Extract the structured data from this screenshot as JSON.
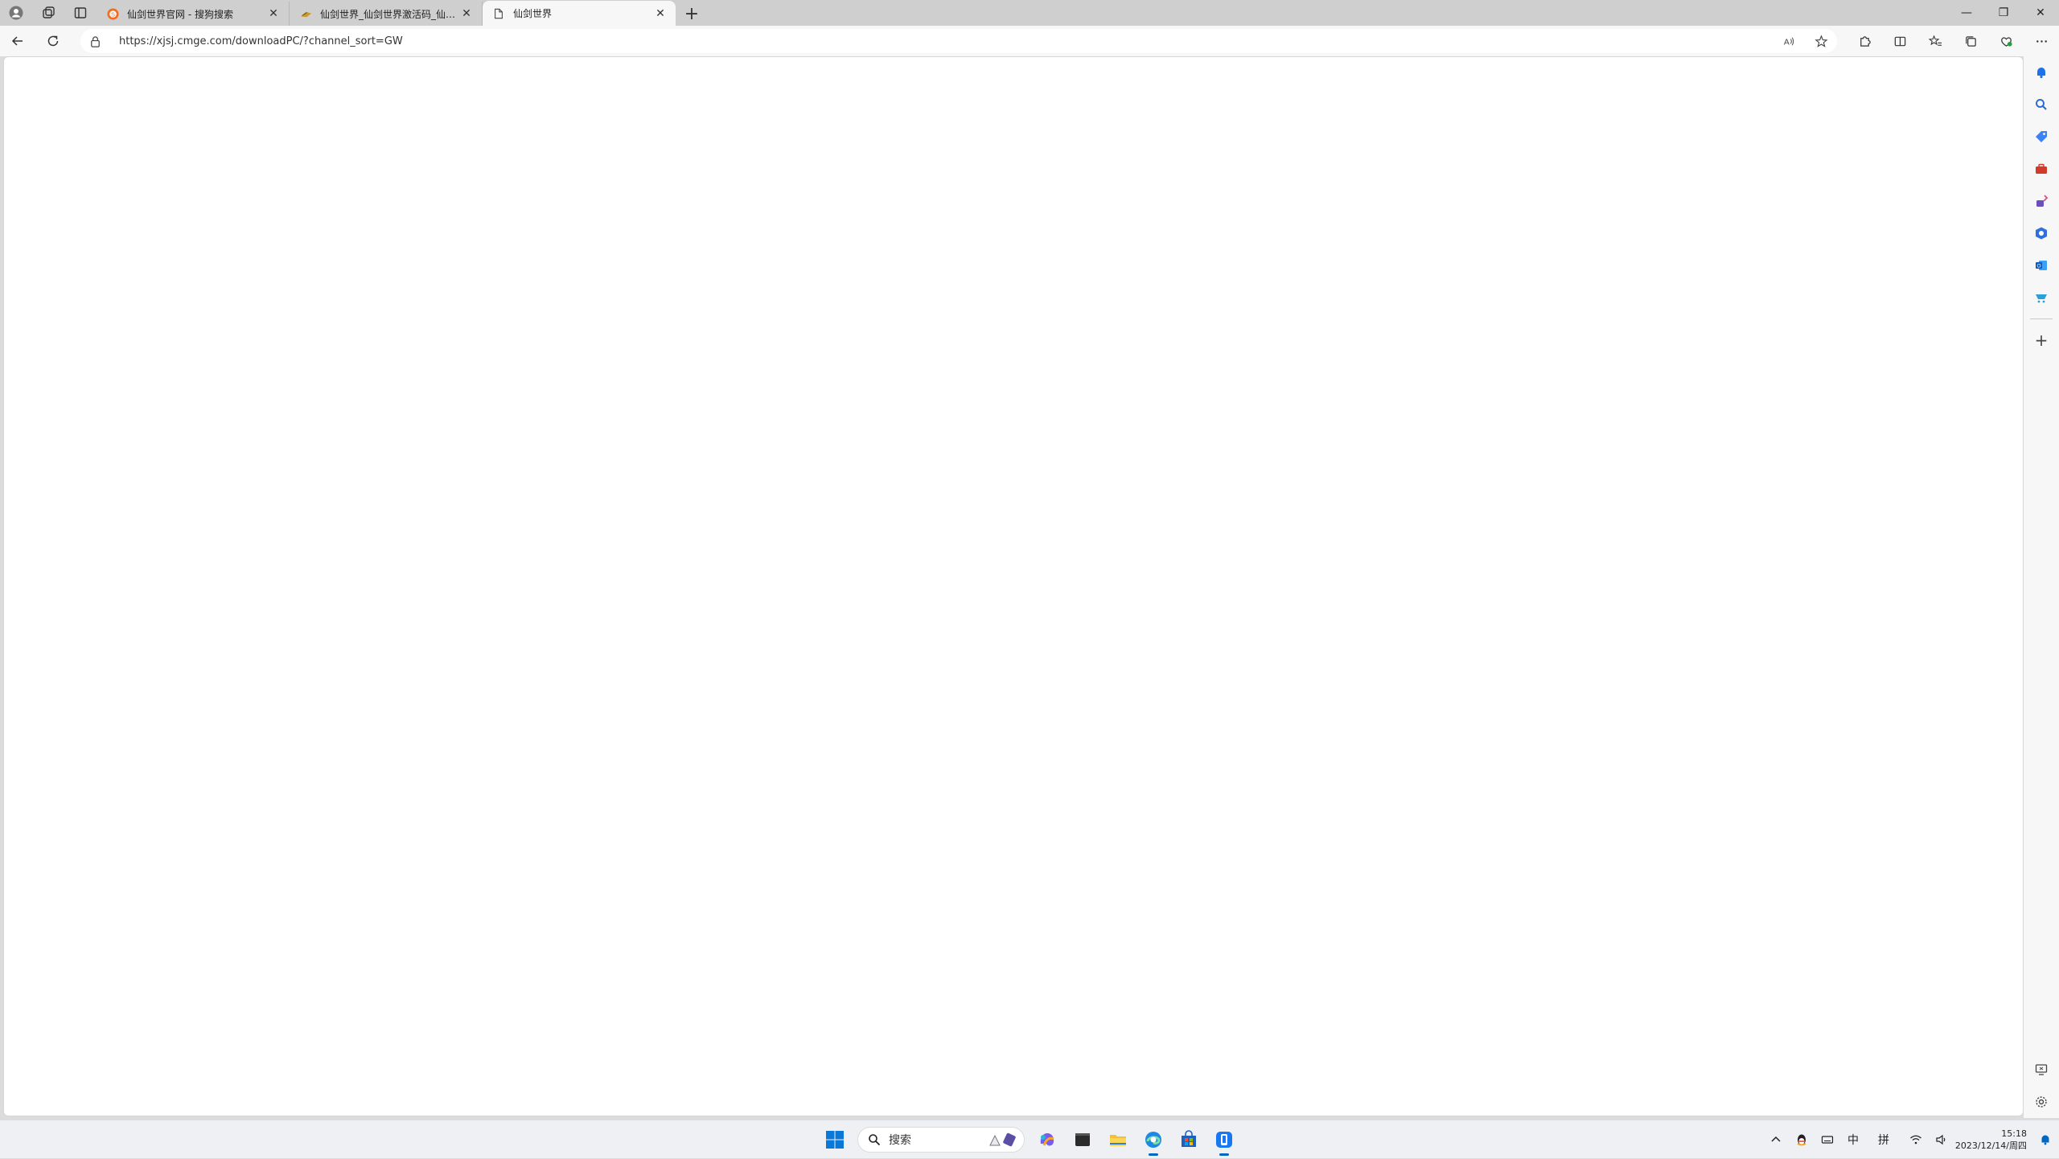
{
  "browser": {
    "tabs": [
      {
        "title": "仙剑世界官网 - 搜狗搜索",
        "favicon": "sogou-icon",
        "active": false
      },
      {
        "title": "仙剑世界_仙剑世界激活码_仙剑世界",
        "favicon": "game-site-icon",
        "active": false
      },
      {
        "title": "仙剑世界",
        "favicon": "blank-page-icon",
        "active": true
      }
    ],
    "new_tab_label": "+",
    "address": {
      "url": "https://xjsj.cmge.com/downloadPC/?channel_sort=GW"
    }
  },
  "sidebar": {
    "items": [
      "bell-icon",
      "search-icon",
      "tag-icon",
      "toolbox-icon",
      "game-icon",
      "office-icon",
      "outlook-icon",
      "shopping-icon"
    ],
    "add_label": "+"
  },
  "taskbar": {
    "search_placeholder": "搜索",
    "apps": [
      "windows-start-icon",
      "copilot-icon",
      "terminal-icon",
      "file-explorer-icon",
      "edge-icon",
      "store-icon",
      "app-icon"
    ],
    "tray": {
      "ime_mode": "中",
      "ime_name": "拼",
      "time": "15:18",
      "date": "2023/12/14/周四"
    }
  },
  "colors": {
    "accent": "#0067c0",
    "tabstrip": "#cfcfcf",
    "toolbar": "#f7f7f7",
    "taskbar": "#eef0f4"
  }
}
